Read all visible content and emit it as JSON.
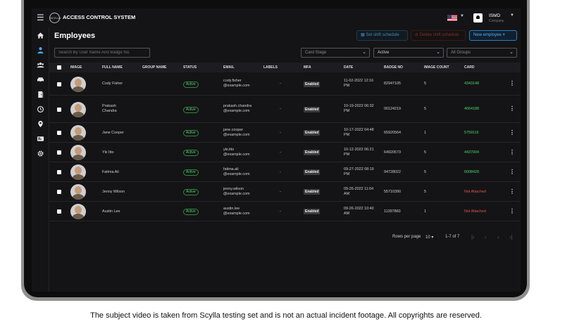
{
  "app": {
    "title": "ACCESS CONTROL SYSTEM",
    "logo_text": "SCYLLA"
  },
  "header": {
    "language_flag": "us-flag-icon",
    "user_name": "ISMD",
    "user_company": "Company"
  },
  "sidebar": {
    "items": [
      "home-icon",
      "person-icon",
      "group-icon",
      "vehicle-icon",
      "door-icon",
      "history-icon",
      "location-pin-icon",
      "id-card-icon",
      "gear-icon"
    ],
    "active_index": 1
  },
  "page": {
    "title": "Employees",
    "buttons": {
      "set_shift": "Set shift schedule",
      "delete_shift": "Delete shift schedule",
      "new_employee": "New employee"
    }
  },
  "filters": {
    "search_placeholder": "Search By User Name And Badge No.",
    "card_stage": "Card Stage",
    "status": "Active",
    "groups": "All Groups"
  },
  "table": {
    "columns": {
      "image": "IMAGE",
      "full_name": "FULL NAME",
      "group_name": "GROUP NAME",
      "status": "STATUS",
      "email": "EMAIL",
      "labels": "LABELS",
      "mfa": "MFA",
      "date": "DATE",
      "badge_no": "BADGE NO",
      "image_count": "IMAGE COUNT",
      "card": "CARD"
    },
    "rows": [
      {
        "name_1": "Cody Fisher",
        "name_2": "",
        "status": "Active",
        "email_1": "cody.fisher",
        "email_2": "@example.com",
        "labels": "-",
        "mfa": "Enabled",
        "date_1": "11-02-2022 12:16",
        "date_2": "PM",
        "badge": "82947105",
        "count": "5",
        "card": "4343148",
        "card_attached": true
      },
      {
        "name_1": "Prakash",
        "name_2": "Chandra",
        "status": "Active",
        "email_1": "prakash.chandra",
        "email_2": "@example.com",
        "labels": "-",
        "mfa": "Enabled",
        "date_1": "10-19-2022 06:32",
        "date_2": "PM",
        "badge": "00124219",
        "count": "5",
        "card": "4664188",
        "card_attached": true
      },
      {
        "name_1": "Jane Cooper",
        "name_2": "",
        "status": "Active",
        "email_1": "jane.cooper",
        "email_2": "@example.com",
        "labels": "-",
        "mfa": "Enabled",
        "date_1": "10-17-2022 04:48",
        "date_2": "PM",
        "badge": "65920564",
        "count": "1",
        "card": "5759116",
        "card_attached": true
      },
      {
        "name_1": "Yki Itto",
        "name_2": "",
        "status": "Active",
        "email_1": "yki.itto",
        "email_2": "@example.com",
        "labels": "-",
        "mfa": "Enabled",
        "date_1": "10-12-2022 06:21",
        "date_2": "PM",
        "badge": "64920573",
        "count": "5",
        "card": "4437004",
        "card_attached": true
      },
      {
        "name_1": "Fatima Ali",
        "name_2": "",
        "status": "Active",
        "email_1": "fatima.ali",
        "email_2": "@example.com",
        "labels": "-",
        "mfa": "Enabled",
        "date_1": "09-27-2022 08:19",
        "date_2": "PM",
        "badge": "94728022",
        "count": "5",
        "card": "6008428",
        "card_attached": true
      },
      {
        "name_1": "Jenny Wilson",
        "name_2": "",
        "status": "Active",
        "email_1": "jenny.wilson",
        "email_2": "@example.com",
        "labels": "-",
        "mfa": "Enabled",
        "date_1": "09-26-2022 11:04",
        "date_2": "AM",
        "badge": "55710390",
        "count": "5",
        "card": "Not Attached",
        "card_attached": false
      },
      {
        "name_1": "Austin Lee",
        "name_2": "",
        "status": "Active",
        "email_1": "austin.lee",
        "email_2": "@example.com",
        "labels": "-",
        "mfa": "Enabled",
        "date_1": "09-26-2022 10:40",
        "date_2": "AM",
        "badge": "11397860",
        "count": "1",
        "card": "Not Attached",
        "card_attached": false
      }
    ]
  },
  "pagination": {
    "rows_per_page_label": "Rows per page",
    "rows_per_page": "10",
    "range": "1-7 of 7"
  },
  "colors": {
    "card_green": "#4cd964",
    "card_red": "#e0524a"
  },
  "caption": "The subject video is taken from Scylla testing set and is not an actual incident footage. All copyrights are reserved."
}
